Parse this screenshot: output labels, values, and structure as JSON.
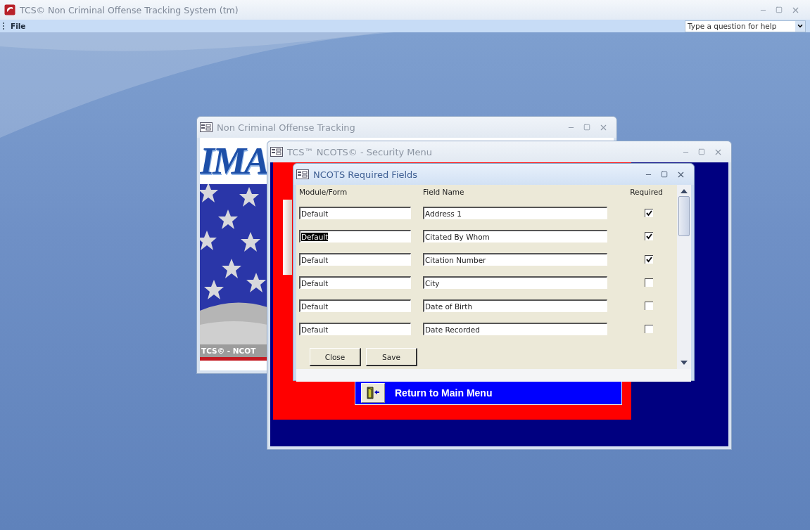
{
  "app": {
    "title": "TCS© Non Criminal Offense Tracking System (tm)",
    "menu": [
      {
        "label": "File"
      }
    ],
    "help_box": {
      "placeholder": "Type a question for help"
    }
  },
  "windows": [
    {
      "kind": "splash",
      "active": false,
      "title": "Non Criminal Offense Tracking",
      "logo_text": "IMA",
      "footer_text": "TCS© - NCOT"
    },
    {
      "kind": "menu",
      "active": false,
      "title": "TCS™ NCOTS© - Security Menu",
      "menu_button": {
        "label": "Return to Main Menu"
      }
    },
    {
      "kind": "form",
      "active": true,
      "title": "NCOTS Required Fields",
      "columns": [
        "Module/Form",
        "Field Name",
        "Required"
      ],
      "rows": [
        {
          "module": "Default",
          "field": "Address 1",
          "required": true,
          "selected": false
        },
        {
          "module": "Default",
          "field": "Citated By Whom",
          "required": true,
          "selected": true
        },
        {
          "module": "Default",
          "field": "Citation Number",
          "required": true,
          "selected": false
        },
        {
          "module": "Default",
          "field": "City",
          "required": false,
          "selected": false
        },
        {
          "module": "Default",
          "field": "Date of Birth",
          "required": false,
          "selected": false
        },
        {
          "module": "Default",
          "field": "Date Recorded",
          "required": false,
          "selected": false
        }
      ],
      "buttons": [
        "Close",
        "Save"
      ]
    }
  ]
}
